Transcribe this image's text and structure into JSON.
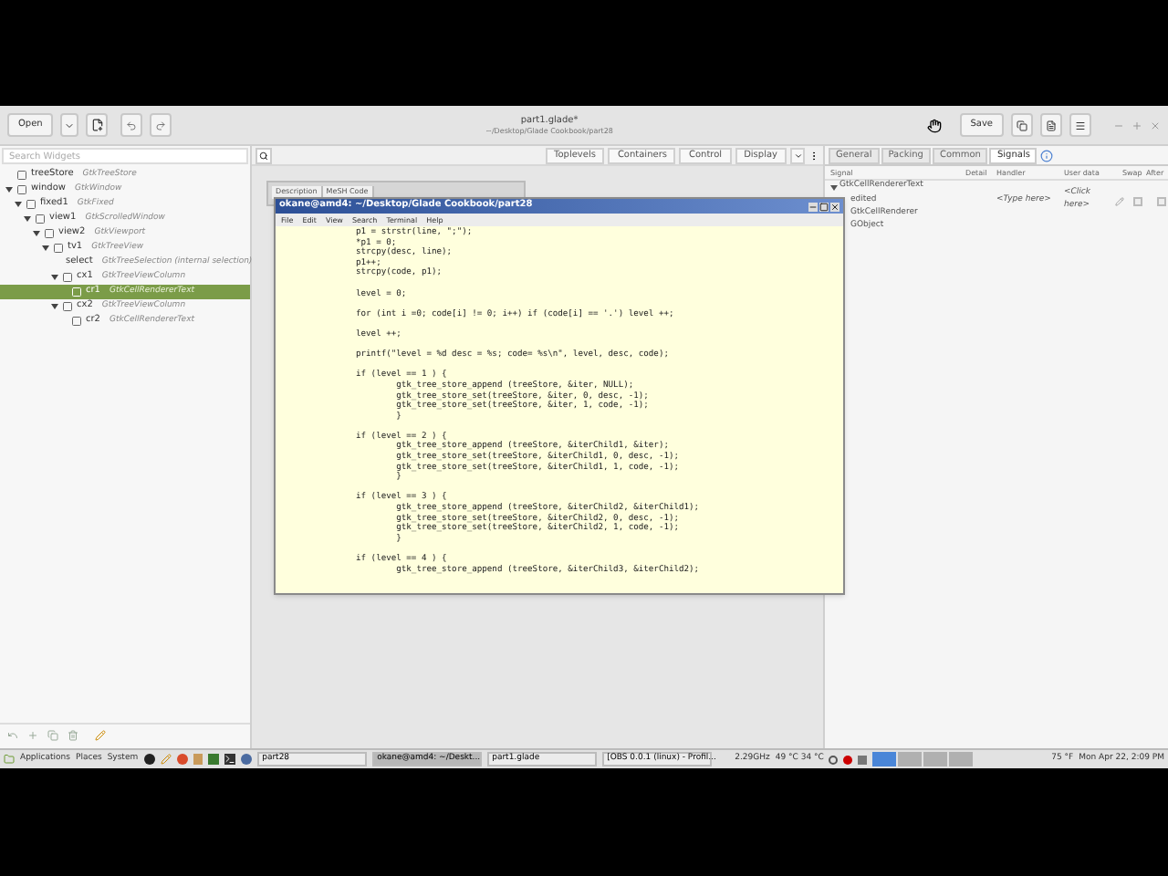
{
  "header": {
    "open_button": "Open",
    "title": "part1.glade*",
    "subtitle": "~/Desktop/Glade Cookbook/part28",
    "save_button": "Save"
  },
  "widget_search": {
    "placeholder": "Search Widgets"
  },
  "widget_tree": [
    {
      "name": "treeStore",
      "type": "GtkTreeStore",
      "selected": false
    },
    {
      "name": "window",
      "type": "GtkWindow",
      "selected": false,
      "expanded": true,
      "children": [
        {
          "name": "fixed1",
          "type": "GtkFixed",
          "selected": false,
          "expanded": true,
          "children": [
            {
              "name": "view1",
              "type": "GtkScrolledWindow",
              "selected": false,
              "expanded": true,
              "children": [
                {
                  "name": "view2",
                  "type": "GtkViewport",
                  "selected": false,
                  "expanded": true,
                  "children": [
                    {
                      "name": "tv1",
                      "type": "GtkTreeView",
                      "selected": false,
                      "expanded": true,
                      "children": [
                        {
                          "name": "select",
                          "type": "GtkTreeSelection (internal selection)",
                          "selected": false
                        },
                        {
                          "name": "cx1",
                          "type": "GtkTreeViewColumn",
                          "selected": false,
                          "expanded": true,
                          "children": [
                            {
                              "name": "cr1",
                              "type": "GtkCellRendererText",
                              "selected": true
                            }
                          ]
                        },
                        {
                          "name": "cx2",
                          "type": "GtkTreeViewColumn",
                          "selected": false,
                          "expanded": true,
                          "children": [
                            {
                              "name": "cr2",
                              "type": "GtkCellRendererText",
                              "selected": false
                            }
                          ]
                        }
                      ]
                    }
                  ]
                }
              ]
            }
          ]
        }
      ]
    }
  ],
  "palette": {
    "groups": [
      "Toplevels",
      "Containers",
      "Control",
      "Display"
    ]
  },
  "preview": {
    "columns": [
      "Description",
      "MeSH Code"
    ]
  },
  "terminal": {
    "title": "okane@amd4: ~/Desktop/Glade Cookbook/part28",
    "menu": [
      "File",
      "Edit",
      "View",
      "Search",
      "Terminal",
      "Help"
    ],
    "code_blocks": [
      [
        "p1 = strstr(line, \";\");",
        "*p1 = 0;",
        "strcpy(desc, line);",
        "p1++;",
        "strcpy(code, p1);"
      ],
      [
        "level = 0;"
      ],
      [
        "for (int i =0; code[i] != 0; i++) if (code[i] == '.') level ++;"
      ],
      [
        "level ++;"
      ],
      [
        "printf(\"level = %d desc = %s; code= %s\\n\", level, desc, code);"
      ],
      [
        "if (level == 1 ) {",
        "        gtk_tree_store_append (treeStore, &iter, NULL);",
        "        gtk_tree_store_set(treeStore, &iter, 0, desc, -1);",
        "        gtk_tree_store_set(treeStore, &iter, 1, code, -1);",
        "        }"
      ],
      [
        "if (level == 2 ) {",
        "        gtk_tree_store_append (treeStore, &iterChild1, &iter);",
        "        gtk_tree_store_set(treeStore, &iterChild1, 0, desc, -1);",
        "        gtk_tree_store_set(treeStore, &iterChild1, 1, code, -1);",
        "        }"
      ],
      [
        "if (level == 3 ) {",
        "        gtk_tree_store_append (treeStore, &iterChild2, &iterChild1);",
        "        gtk_tree_store_set(treeStore, &iterChild2, 0, desc, -1);",
        "        gtk_tree_store_set(treeStore, &iterChild2, 1, code, -1);",
        "        }"
      ],
      [
        "if (level == 4 ) {",
        "        gtk_tree_store_append (treeStore, &iterChild3, &iterChild2);"
      ]
    ]
  },
  "inspector": {
    "tabs": [
      {
        "label": "General",
        "selected": false
      },
      {
        "label": "Packing",
        "selected": false
      },
      {
        "label": "Common",
        "selected": false
      },
      {
        "label": "Signals",
        "selected": true
      }
    ],
    "columns": [
      "Signal",
      "Detail",
      "Handler",
      "User data",
      "Swap",
      "After"
    ],
    "signals": [
      {
        "name": "GtkCellRendererText",
        "expanded": true,
        "children": [
          {
            "name": "edited",
            "handler": "<Type here>",
            "user_data": "<Click here>",
            "swap": false,
            "after": false
          }
        ]
      },
      {
        "name": "GtkCellRenderer"
      },
      {
        "name": "GObject"
      }
    ]
  },
  "taskbar": {
    "menus": [
      "Applications",
      "Places",
      "System"
    ],
    "tasks": [
      {
        "label": "part28",
        "selected": false
      },
      {
        "label": "okane@amd4: ~/Deskt...",
        "selected": true
      },
      {
        "label": "part1.glade",
        "selected": false
      },
      {
        "label": "[OBS 0.0.1 (linux) - Profil...",
        "selected": false
      }
    ],
    "cpu": "2.29GHz",
    "temps": "49 °C 34 °C",
    "workspaces": [
      {
        "selected": true
      },
      {
        "selected": false
      },
      {
        "selected": false
      },
      {
        "selected": false
      }
    ],
    "weather": "75 °F",
    "clock": "Mon Apr 22, 2:09 PM"
  }
}
